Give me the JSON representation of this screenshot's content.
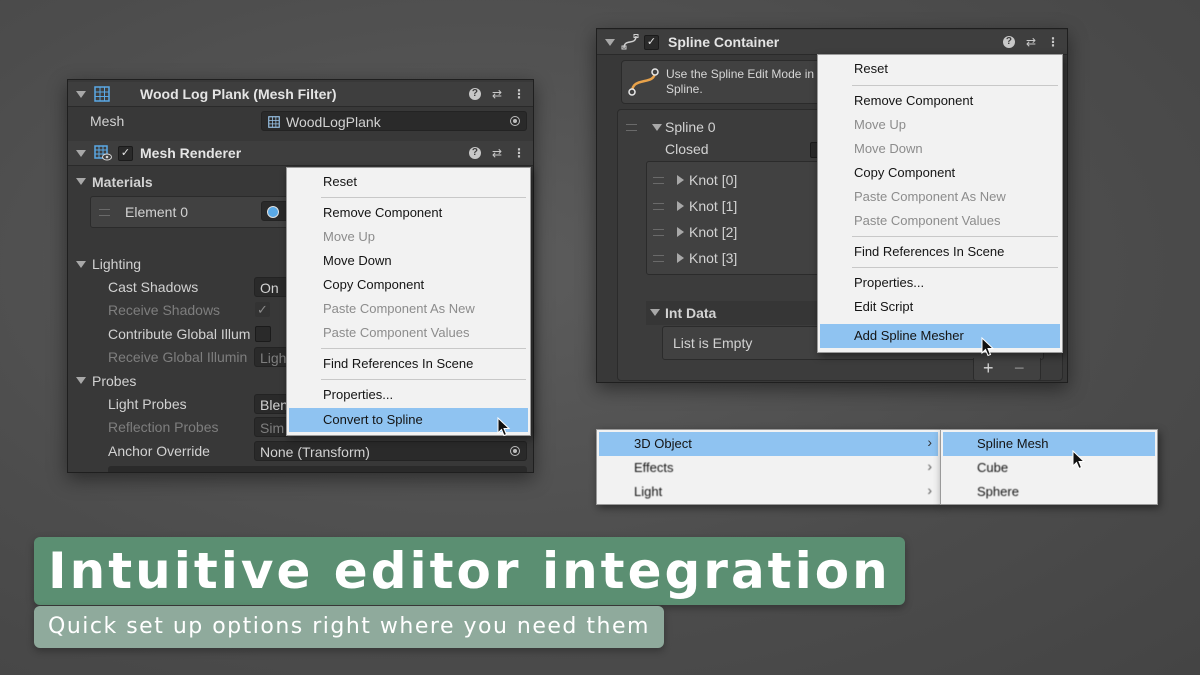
{
  "left_panel": {
    "mesh_filter": {
      "title": "Wood Log Plank (Mesh Filter)",
      "mesh_label": "Mesh",
      "mesh_value": "WoodLogPlank"
    },
    "mesh_renderer": {
      "title": "Mesh Renderer"
    },
    "materials": {
      "label": "Materials",
      "element": "Element 0"
    },
    "lighting": {
      "label": "Lighting",
      "cast_shadows": "Cast Shadows",
      "cast_shadows_value": "On",
      "receive_shadows": "Receive Shadows",
      "receive_shadows_check": "✓",
      "contribute_gi": "Contribute Global Illum",
      "receive_gi": "Receive Global Illumin",
      "receive_gi_value": "Ligh"
    },
    "probes": {
      "label": "Probes",
      "light_probes": "Light Probes",
      "light_probes_value": "Blen",
      "reflection_probes": "Reflection Probes",
      "reflection_probes_value": "Sim",
      "anchor_override": "Anchor Override",
      "anchor_override_value": "None (Transform)"
    },
    "context_menu": [
      {
        "label": "Reset",
        "state": "normal"
      },
      {
        "label": "Remove Component",
        "state": "normal"
      },
      {
        "label": "Move Up",
        "state": "disabled"
      },
      {
        "label": "Move Down",
        "state": "normal"
      },
      {
        "label": "Copy Component",
        "state": "normal"
      },
      {
        "label": "Paste Component As New",
        "state": "disabled"
      },
      {
        "label": "Paste Component Values",
        "state": "disabled"
      },
      {
        "label": "Find References In Scene",
        "state": "normal"
      },
      {
        "label": "Properties...",
        "state": "normal"
      },
      {
        "label": "Convert to Spline",
        "state": "selected"
      }
    ]
  },
  "right_panel": {
    "title": "Spline Container",
    "help_text_line1": "Use the Spline Edit Mode in",
    "help_text_line2": "Spline.",
    "spline_label": "Spline 0",
    "closed_label": "Closed",
    "knots": [
      "Knot [0]",
      "Knot [1]",
      "Knot [2]",
      "Knot [3]"
    ],
    "int_data_label": "Int Data",
    "list_empty": "List is Empty",
    "add_symbol": "+",
    "remove_symbol": "−",
    "context_menu": [
      {
        "label": "Reset",
        "state": "normal"
      },
      {
        "label": "Remove Component",
        "state": "normal"
      },
      {
        "label": "Move Up",
        "state": "disabled"
      },
      {
        "label": "Move Down",
        "state": "disabled"
      },
      {
        "label": "Copy Component",
        "state": "normal"
      },
      {
        "label": "Paste Component As New",
        "state": "disabled"
      },
      {
        "label": "Paste Component Values",
        "state": "disabled"
      },
      {
        "label": "Find References In Scene",
        "state": "normal"
      },
      {
        "label": "Properties...",
        "state": "normal"
      },
      {
        "label": "Edit Script",
        "state": "normal"
      },
      {
        "label": "Add Spline Mesher",
        "state": "selected"
      }
    ]
  },
  "create_menu": {
    "items": [
      "3D Object",
      "Effects",
      "Light"
    ],
    "submenu": [
      "Spline Mesh",
      "Cube",
      "Sphere"
    ]
  },
  "headline": "Intuitive editor integration",
  "subheadline": "Quick set up options right where you need them",
  "colors": {
    "selection": "#8fc3f1",
    "headline_bg": "#5b8f72",
    "subheadline_bg": "#8faa9c"
  }
}
